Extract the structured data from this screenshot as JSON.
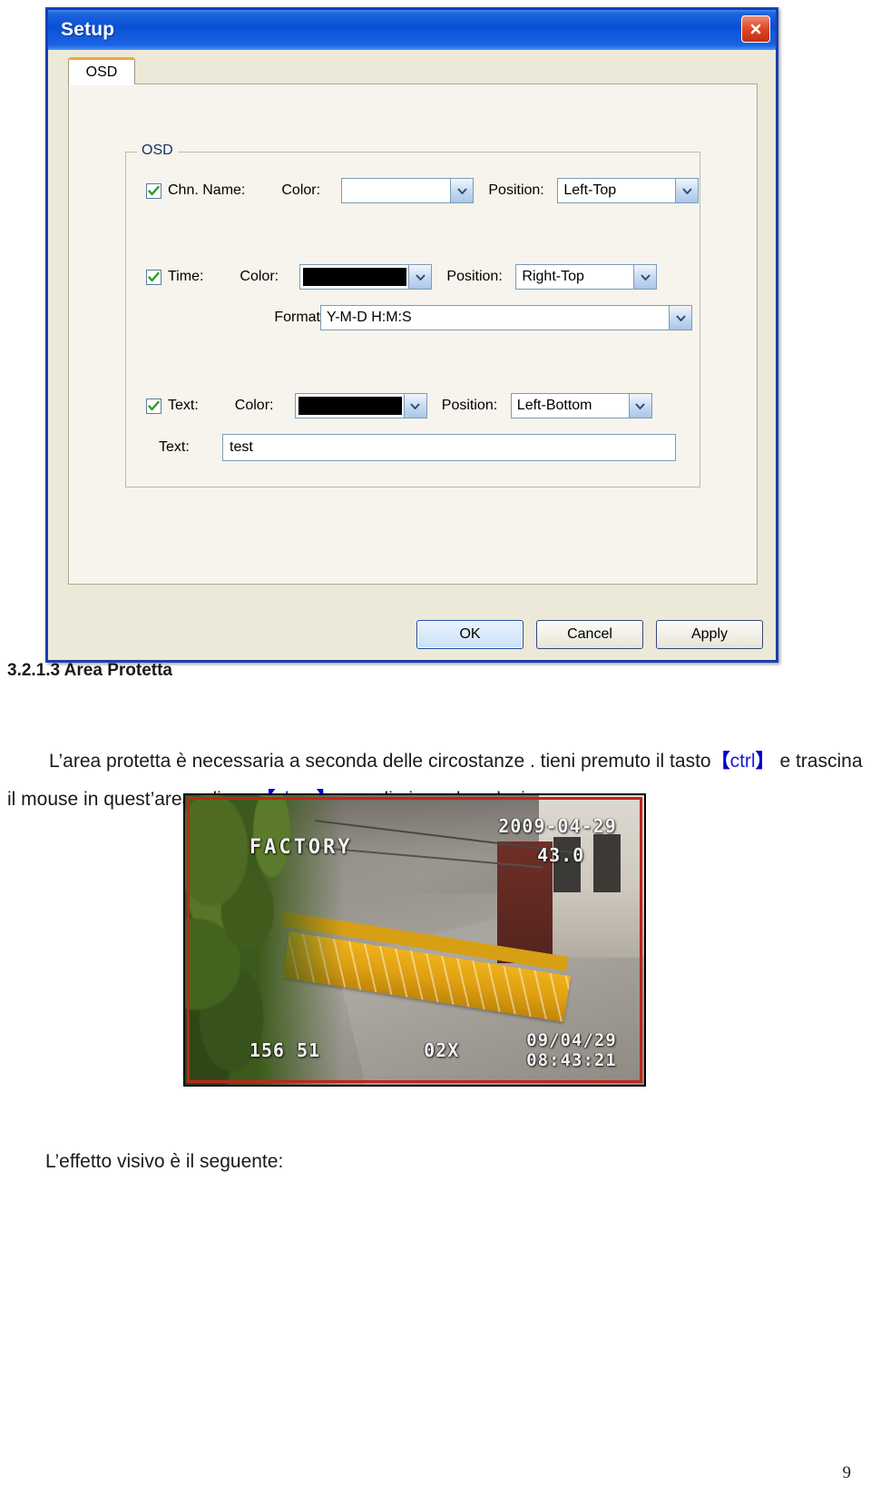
{
  "dialog": {
    "title": "Setup",
    "close_icon": "close-x-icon",
    "tabs": [
      {
        "label": "OSD",
        "selected": true
      }
    ],
    "group": {
      "title": "OSD",
      "rows": {
        "chn_name": {
          "checkbox_label": "Chn. Name:",
          "checked": true,
          "color_caption": "Color:",
          "color_value": "#ffffff",
          "position_caption": "Position:",
          "position_value": "Left-Top"
        },
        "time": {
          "checkbox_label": "Time:",
          "checked": true,
          "color_caption": "Color:",
          "color_value": "#000000",
          "position_caption": "Position:",
          "position_value": "Right-Top",
          "format_caption": "Format",
          "format_value": "Y-M-D H:M:S"
        },
        "text": {
          "checkbox_label": "Text:",
          "checked": true,
          "color_caption": "Color:",
          "color_value": "#000000",
          "position_caption": "Position:",
          "position_value": "Left-Bottom",
          "text_caption": "Text:",
          "text_value": "test"
        }
      }
    },
    "buttons": {
      "ok": "OK",
      "cancel": "Cancel",
      "apply": "Apply"
    }
  },
  "document": {
    "heading": "3.2.1.3 Area Protetta",
    "paragraph": {
      "part1": "L’area protetta è necessaria a seconda delle circostanze . tieni premuto il tasto",
      "key1_open": "【",
      "key1": "ctrl",
      "key1_close": "】",
      "part2": "e",
      "part3": "trascina il mouse in quest’area, clicca",
      "key2_open": "【",
      "key2": "clear",
      "key2_close": "】",
      "part4": "per eliminare la selezione."
    },
    "caption": "L’effetto visivo è il seguente:",
    "page_number": "9"
  },
  "photo": {
    "alt": "surveillance-camera-frame",
    "overlays": {
      "channel_name": "FACTORY",
      "timestamp_top": "2009-04-29",
      "temperature": "43.0",
      "coordinates": "156 51",
      "zoom": "02X",
      "date_stamp": "09/04/29",
      "time_stamp": "08:43:21"
    },
    "selection_color": "#c0241c"
  }
}
